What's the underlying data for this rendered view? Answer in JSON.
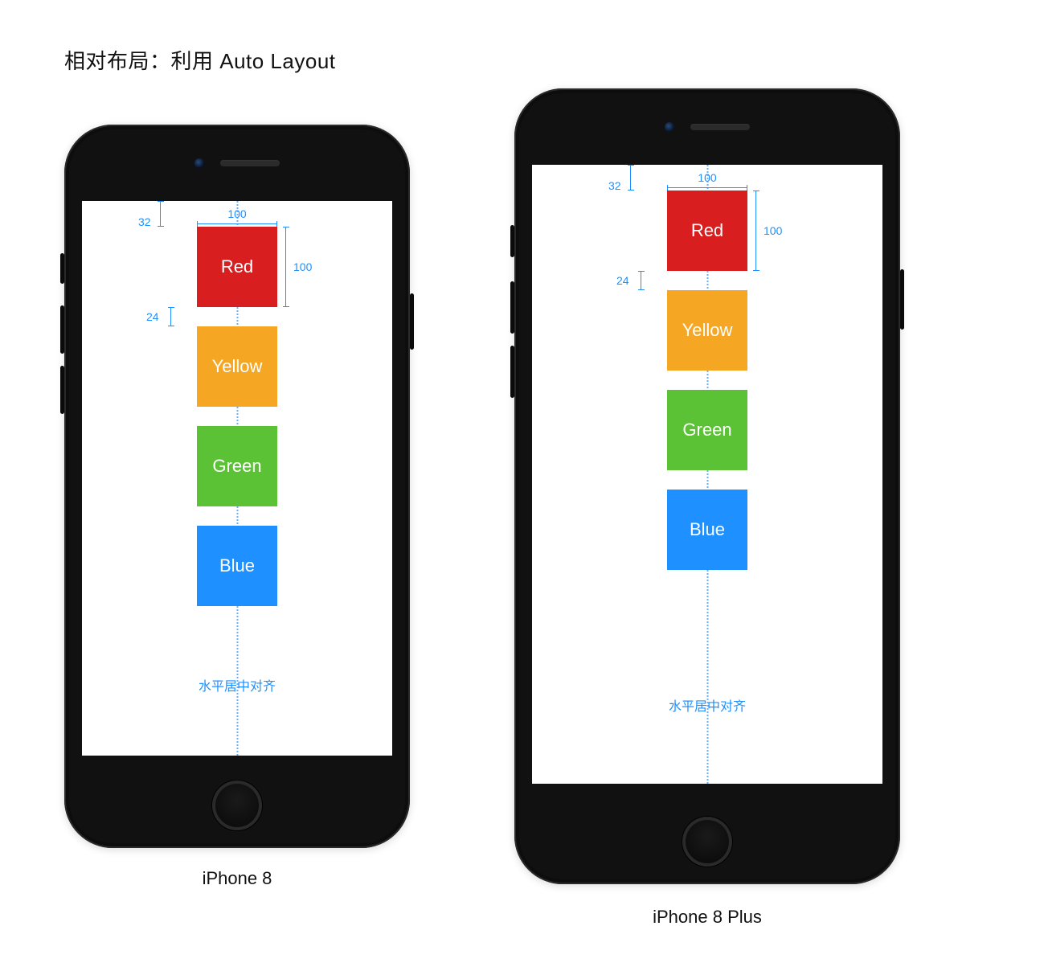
{
  "page_title": "相对布局：利用 Auto Layout",
  "devices": {
    "left": {
      "label": "iPhone 8"
    },
    "right": {
      "label": "iPhone 8 Plus"
    }
  },
  "blocks": {
    "red": {
      "label": "Red",
      "color": "#d81e1e"
    },
    "yellow": {
      "label": "Yellow",
      "color": "#f5a623"
    },
    "green": {
      "label": "Green",
      "color": "#5bc236"
    },
    "blue": {
      "label": "Blue",
      "color": "#1e90ff"
    }
  },
  "annotations": {
    "top_margin": "32",
    "block_width": "100",
    "block_height": "100",
    "vertical_gap": "24",
    "center_label": "水平居中对齐"
  }
}
